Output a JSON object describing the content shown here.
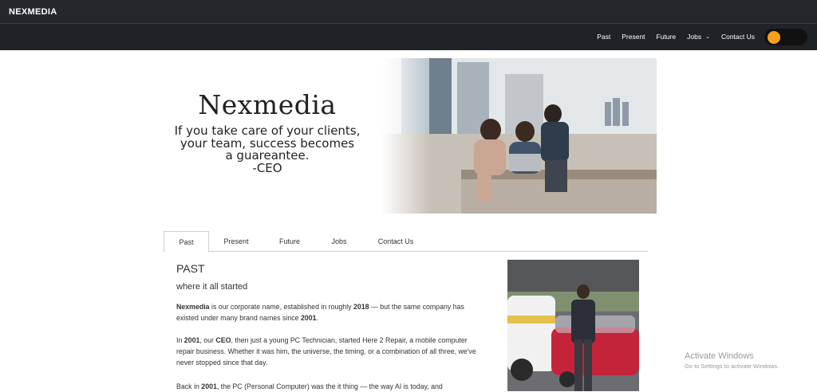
{
  "brand": "NEXMEDIA",
  "nav": {
    "items": [
      "Past",
      "Present",
      "Future",
      "Jobs",
      "Contact Us"
    ]
  },
  "hero": {
    "title": "Nexmedia",
    "quote_lines": [
      "If you take care of your clients,",
      "your team, success becomes",
      "a guareantee.",
      "-CEO"
    ]
  },
  "tabs": [
    "Past",
    "Present",
    "Future",
    "Jobs",
    "Contact Us"
  ],
  "active_tab": "Past",
  "section": {
    "title": "PAST",
    "subtitle": "where it all started",
    "p1": {
      "b1": "Nexmedia",
      "t1": " is our corporate name, established in roughly ",
      "b2": "2018",
      "t2": " — but the same company has existed under many brand names since ",
      "b3": "2001",
      "t3": "."
    },
    "p2": {
      "t0": "In ",
      "b1": "2001",
      "t1": ", our ",
      "b2": "CEO",
      "t2": ", then just a young PC Technician, started Here 2 Repair, a mobile computer repair business. Whether it was him, the universe, the timing, or a combination of all three, we've never stopped since that day."
    },
    "p3": {
      "t0": "Back in ",
      "b1": "2001",
      "t1": ", the PC (Personal Computer) was the it thing — the way AI is today, and"
    }
  },
  "watermark": {
    "line1": "Activate Windows",
    "line2": "Go to Settings to activate Windows."
  },
  "colors": {
    "accent": "#f5a21b",
    "navbar": "#1f2226",
    "topbar": "#24272b"
  }
}
